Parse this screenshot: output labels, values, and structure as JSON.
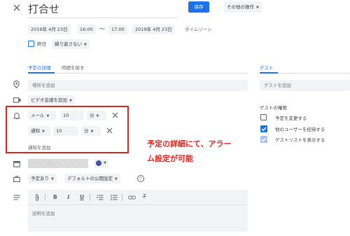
{
  "header": {
    "close_icon": "close-icon",
    "title": "打合せ",
    "save_label": "保存",
    "more_actions_label": "その他の操作"
  },
  "datetime": {
    "start_date": "2019年 4月 23日",
    "start_time": "16:00",
    "separator": "〜",
    "end_time": "17:00",
    "end_date": "2019年 4月 23日",
    "timezone_label": "タイムゾーン",
    "all_day_label": "終日",
    "repeat_label": "繰り返さない"
  },
  "tabs": {
    "details": "予定の詳細",
    "find_time": "時間を探す",
    "guests": "ゲスト"
  },
  "details": {
    "location_placeholder": "場所を追加",
    "conference_label": "ビデオ会議を追加",
    "notification1_type": "メール",
    "notification1_value": "10",
    "notification1_unit": "分",
    "notification2_type": "通知",
    "notification2_value": "10",
    "notification2_unit": "分",
    "add_notification_label": "通知を追加",
    "availability_label": "予定あり",
    "visibility_label": "デフォルトの公開設定",
    "description_placeholder": "説明を追加"
  },
  "guests": {
    "add_guest_placeholder": "ゲストを追加",
    "permissions_heading": "ゲストの権限",
    "permissions": [
      {
        "label": "予定を変更する",
        "checked": false
      },
      {
        "label": "他のユーザーを招待する",
        "checked": true
      },
      {
        "label": "ゲストリストを表示する",
        "checked": true
      }
    ]
  },
  "annotation": {
    "line1": "予定の詳細にて、アラー",
    "line2": "ム設定が可能",
    "color": "#e8231e"
  },
  "colors": {
    "accent": "#1a73e8",
    "event_color": "#3f51b5",
    "highlight_box": "#d3281f"
  }
}
